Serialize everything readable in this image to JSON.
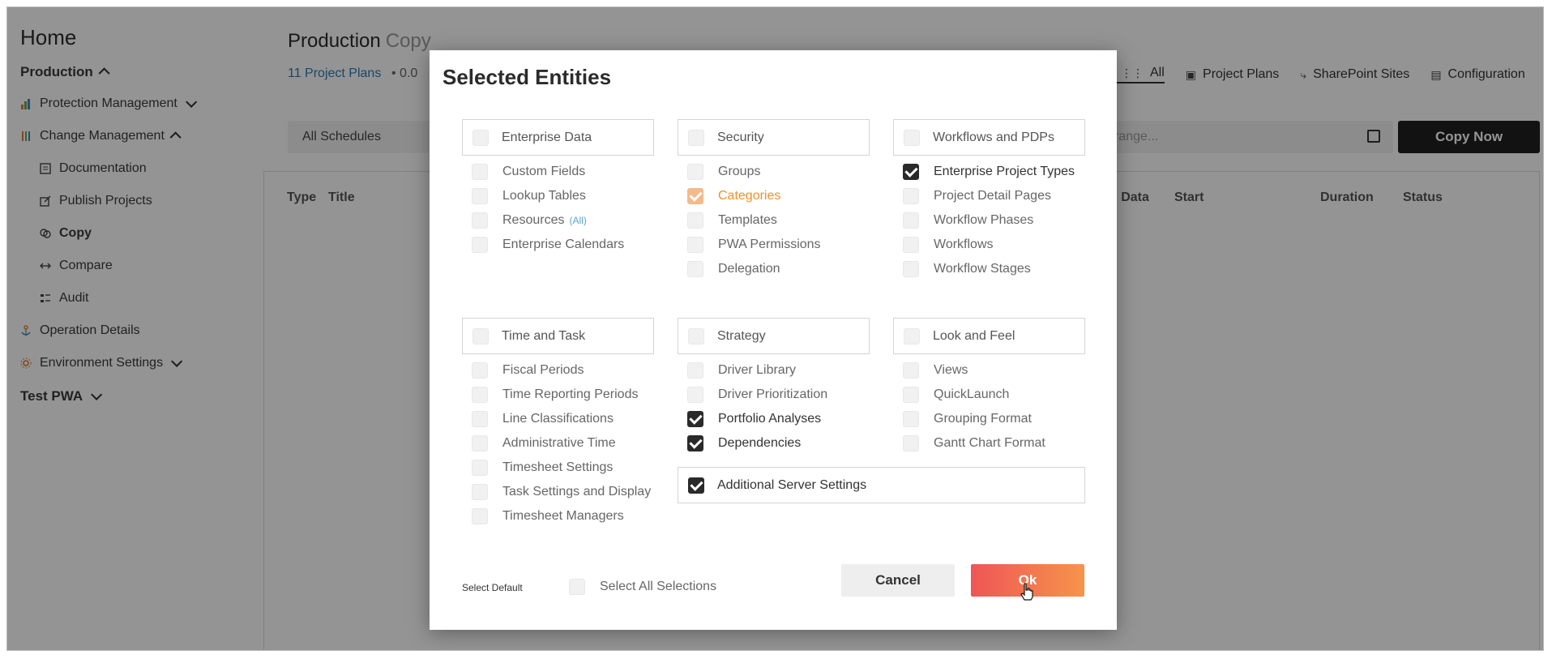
{
  "sidebar": {
    "home": "Home",
    "production": "Production",
    "items": [
      {
        "label": "Protection Management",
        "icon": "bar-chart-icon"
      },
      {
        "label": "Change Management",
        "icon": "sliders-icon"
      },
      {
        "label": "Documentation",
        "icon": "document-icon"
      },
      {
        "label": "Publish Projects",
        "icon": "publish-icon"
      },
      {
        "label": "Copy",
        "icon": "copy-icon"
      },
      {
        "label": "Compare",
        "icon": "compare-arrows-icon"
      },
      {
        "label": "Audit",
        "icon": "audit-list-icon"
      },
      {
        "label": "Operation Details",
        "icon": "anchor-icon"
      },
      {
        "label": "Environment Settings",
        "icon": "gear-icon"
      }
    ],
    "test_pwa": "Test PWA"
  },
  "main": {
    "title": "Production",
    "title_sub": "Copy",
    "plans_link": "11 Project Plans",
    "plans_meta": "• 0.0",
    "tabs": [
      {
        "label": "All",
        "icon": "grid-icon"
      },
      {
        "label": "Project Plans",
        "icon": "project-plans-icon"
      },
      {
        "label": "SharePoint Sites",
        "icon": "sharepoint-icon"
      },
      {
        "label": "Configuration",
        "icon": "configuration-icon"
      }
    ],
    "schedule": "All Schedules",
    "range_placeholder": "range...",
    "copy_now": "Copy Now",
    "columns": [
      "Type",
      "Title",
      "d Data",
      "Start",
      "Duration",
      "Status"
    ]
  },
  "modal": {
    "title": "Selected Entities",
    "groups": {
      "enterprise_data": {
        "label": "Enterprise Data",
        "items": [
          "Custom Fields",
          "Lookup Tables",
          "Resources",
          "Enterprise Calendars"
        ],
        "resources_suffix": "(All)"
      },
      "security": {
        "label": "Security",
        "items": [
          "Groups",
          "Categories",
          "Templates",
          "PWA Permissions",
          "Delegation"
        ]
      },
      "workflows": {
        "label": "Workflows and PDPs",
        "items": [
          "Enterprise Project Types",
          "Project Detail Pages",
          "Workflow Phases",
          "Workflows",
          "Workflow Stages"
        ]
      },
      "time_task": {
        "label": "Time and Task",
        "items": [
          "Fiscal Periods",
          "Time Reporting Periods",
          "Line Classifications",
          "Administrative Time",
          "Timesheet Settings",
          "Task Settings and Display",
          "Timesheet Managers"
        ]
      },
      "strategy": {
        "label": "Strategy",
        "items": [
          "Driver Library",
          "Driver Prioritization",
          "Portfolio Analyses",
          "Dependencies"
        ]
      },
      "look_feel": {
        "label": "Look and Feel",
        "items": [
          "Views",
          "QuickLaunch",
          "Grouping Format",
          "Gantt Chart Format"
        ]
      },
      "additional": {
        "label": "Additional Server Settings"
      }
    },
    "select_default": "Select Default",
    "select_all": "Select All Selections",
    "cancel": "Cancel",
    "ok": "Ok"
  }
}
